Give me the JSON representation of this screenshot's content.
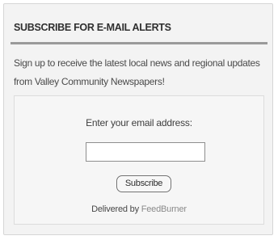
{
  "widget": {
    "title": "SUBSCRIBE FOR E-MAIL ALERTS",
    "intro": "Sign up to receive the latest local news and regional updates from Valley Community Newspapers!"
  },
  "form": {
    "email_label": "Enter your email address:",
    "email_value": "",
    "subscribe_label": "Subscribe",
    "delivered_prefix": "Delivered by",
    "feedburner_link": "FeedBurner"
  },
  "colors": {
    "panel_background": "#f3f3f3",
    "title_rule": "#9a9a9a",
    "link": "#8a8a8a"
  }
}
